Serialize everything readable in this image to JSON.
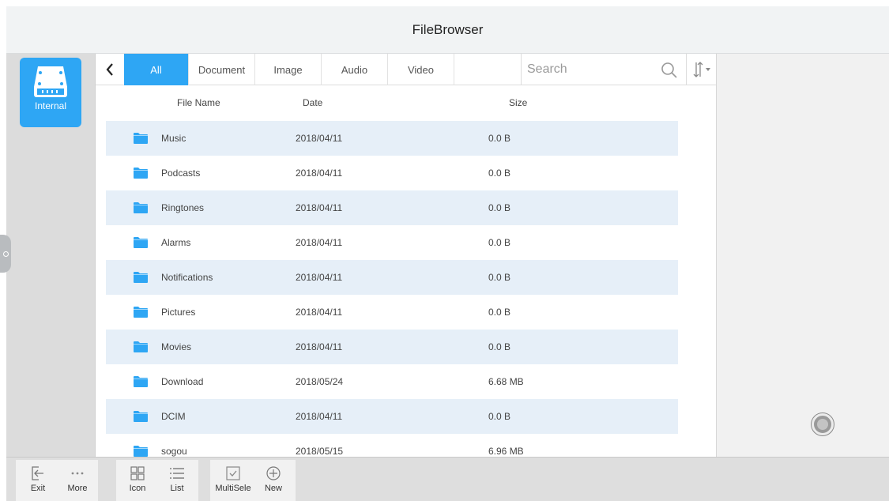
{
  "app": {
    "title": "FileBrowser"
  },
  "sidebar": {
    "storage_label": "Internal"
  },
  "filter": {
    "tabs": [
      {
        "label": "All",
        "active": true
      },
      {
        "label": "Document",
        "active": false
      },
      {
        "label": "Image",
        "active": false
      },
      {
        "label": "Audio",
        "active": false
      },
      {
        "label": "Video",
        "active": false
      }
    ],
    "search_placeholder": "Search"
  },
  "columns": {
    "name": "File Name",
    "date": "Date",
    "size": "Size"
  },
  "files": [
    {
      "name": "Music",
      "date": "2018/04/11",
      "size": "0.0 B",
      "shaded": true
    },
    {
      "name": "Podcasts",
      "date": "2018/04/11",
      "size": "0.0 B",
      "shaded": false
    },
    {
      "name": "Ringtones",
      "date": "2018/04/11",
      "size": "0.0 B",
      "shaded": true
    },
    {
      "name": "Alarms",
      "date": "2018/04/11",
      "size": "0.0 B",
      "shaded": false
    },
    {
      "name": "Notifications",
      "date": "2018/04/11",
      "size": "0.0 B",
      "shaded": true
    },
    {
      "name": "Pictures",
      "date": "2018/04/11",
      "size": "0.0 B",
      "shaded": false
    },
    {
      "name": "Movies",
      "date": "2018/04/11",
      "size": "0.0 B",
      "shaded": true
    },
    {
      "name": "Download",
      "date": "2018/05/24",
      "size": "6.68 MB",
      "shaded": false
    },
    {
      "name": "DCIM",
      "date": "2018/04/11",
      "size": "0.0 B",
      "shaded": true
    },
    {
      "name": "sogou",
      "date": "2018/05/15",
      "size": "6.96 MB",
      "shaded": false
    }
  ],
  "toolbar": {
    "exit": "Exit",
    "more": "More",
    "icon": "Icon",
    "list": "List",
    "multisele": "MultiSele",
    "new": "New"
  },
  "colors": {
    "accent": "#2ea6f4",
    "row_shade": "#e6eff8",
    "folder": "#2ea6f4",
    "toolbar_bg": "#dedede"
  },
  "icons": [
    "storage-drive-icon",
    "back-chevron-icon",
    "search-icon",
    "sort-icon",
    "folder-icon",
    "exit-icon",
    "more-icon",
    "grid-icon",
    "list-icon",
    "checkbox-icon",
    "plus-circle-icon"
  ]
}
